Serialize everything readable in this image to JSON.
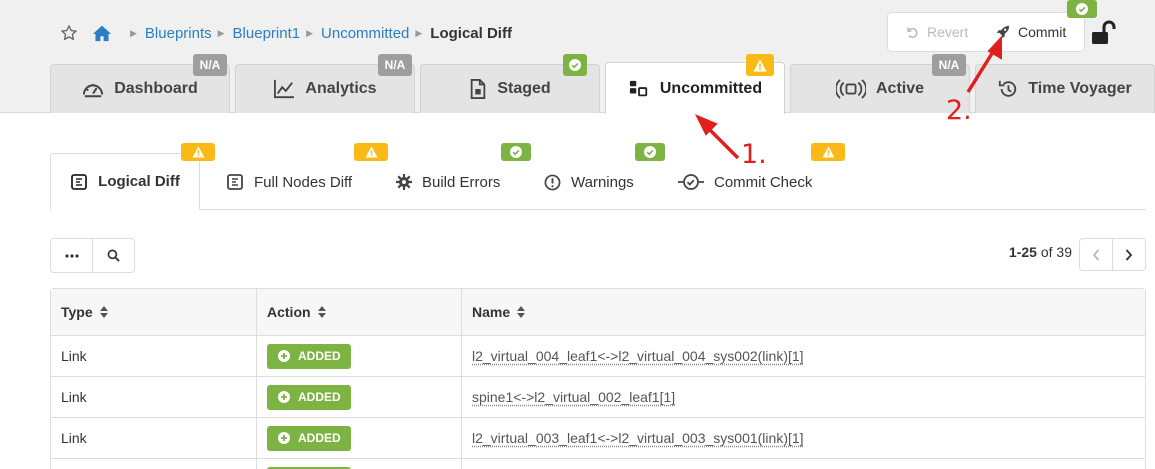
{
  "breadcrumb": {
    "items": [
      "Blueprints",
      "Blueprint1",
      "Uncommitted"
    ],
    "current": "Logical Diff"
  },
  "actions": {
    "revert_label": "Revert",
    "commit_label": "Commit"
  },
  "main_tabs": [
    {
      "label": "Dashboard",
      "badge": "N/A",
      "icon": "dashboard-icon"
    },
    {
      "label": "Analytics",
      "badge": "N/A",
      "icon": "analytics-icon"
    },
    {
      "label": "Staged",
      "badge": "ok",
      "icon": "staged-icon"
    },
    {
      "label": "Uncommitted",
      "badge": "warning",
      "icon": "uncommitted-icon",
      "active": true
    },
    {
      "label": "Active",
      "badge": "N/A",
      "icon": "active-icon"
    },
    {
      "label": "Time Voyager",
      "badge": "",
      "icon": "history-icon"
    }
  ],
  "sub_tabs": [
    {
      "label": "Logical Diff",
      "badge": "warning",
      "active": true
    },
    {
      "label": "Full Nodes Diff",
      "badge": "warning"
    },
    {
      "label": "Build Errors",
      "badge": "ok"
    },
    {
      "label": "Warnings",
      "badge": "ok"
    },
    {
      "label": "Commit Check",
      "badge": "warning"
    }
  ],
  "pagination": {
    "range": "1-25",
    "of": "of",
    "total": "39"
  },
  "table": {
    "columns": [
      "Type",
      "Action",
      "Name"
    ],
    "rows": [
      {
        "type": "Link",
        "action": "ADDED",
        "name": "l2_virtual_004_leaf1<->l2_virtual_004_sys002(link)[1]"
      },
      {
        "type": "Link",
        "action": "ADDED",
        "name": "spine1<->l2_virtual_002_leaf1[1]"
      },
      {
        "type": "Link",
        "action": "ADDED",
        "name": "l2_virtual_003_leaf1<->l2_virtual_003_sys001(link)[1]"
      }
    ]
  },
  "annotations": {
    "step1": "1.",
    "step2": "2."
  },
  "colors": {
    "accent_link": "#2b7ec4",
    "success": "#7cb342",
    "warning": "#fbb917",
    "neutral_badge": "#9e9e9e",
    "annotation": "#e0201c"
  }
}
